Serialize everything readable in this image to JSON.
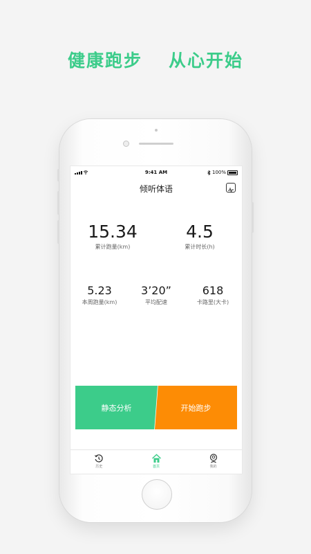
{
  "header": {
    "slogan_left": "健康跑步",
    "slogan_right": "从心开始"
  },
  "status_bar": {
    "time": "9:41 AM",
    "battery": "100%"
  },
  "app": {
    "title": "倾听体语"
  },
  "stats": {
    "total_distance": {
      "value": "15.34",
      "label": "累计跑量(km)"
    },
    "total_duration": {
      "value": "4.5",
      "label": "累计时长(h)"
    },
    "week_distance": {
      "value": "5.23",
      "label": "本周跑量(km)"
    },
    "avg_pace": {
      "value": "3’20”",
      "label": "平均配速"
    },
    "calories": {
      "value": "618",
      "label": "卡路里(大卡)"
    }
  },
  "actions": {
    "static_analysis": "静态分析",
    "start_run": "开始跑步"
  },
  "tabbar": {
    "items": [
      {
        "label": "历史",
        "icon": "history-icon"
      },
      {
        "label": "首页",
        "icon": "home-icon"
      },
      {
        "label": "我的",
        "icon": "profile-icon"
      }
    ]
  },
  "colors": {
    "accent_green": "#3ccc8a",
    "accent_orange": "#fd8c05"
  }
}
